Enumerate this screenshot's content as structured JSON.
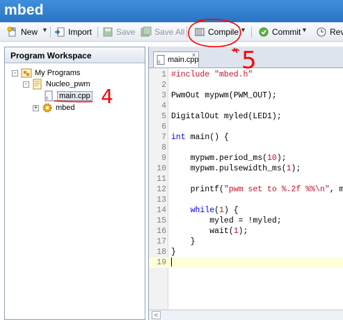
{
  "window": {
    "title": "mbed"
  },
  "toolbar": {
    "new_label": "New",
    "import_label": "Import",
    "save_label": "Save",
    "save_all_label": "Save All",
    "compile_label": "Compile",
    "commit_label": "Commit",
    "revisions_label": "Revi"
  },
  "workspace": {
    "header": "Program Workspace",
    "tree": [
      {
        "label": "My Programs",
        "expander": "-",
        "icon": "programs-folder-icon"
      },
      {
        "label": "Nucleo_pwm",
        "expander": "-",
        "icon": "program-icon"
      },
      {
        "label": "main.cpp",
        "expander": "",
        "icon": "cpp-file-icon",
        "selected": true
      },
      {
        "label": "mbed",
        "expander": "+",
        "icon": "gear-library-icon"
      }
    ]
  },
  "editor": {
    "tab_label": "main.cpp",
    "current_line": 19,
    "lines": [
      {
        "n": "1",
        "html": "<span class=\"pp\">#include \"mbed.h\"</span>"
      },
      {
        "n": "2",
        "html": ""
      },
      {
        "n": "3",
        "html": "PwmOut mypwm(PWM_OUT);"
      },
      {
        "n": "4",
        "html": ""
      },
      {
        "n": "5",
        "html": "DigitalOut myled(LED1);"
      },
      {
        "n": "6",
        "html": ""
      },
      {
        "n": "7",
        "html": "<span class=\"kw\">int</span> main() {"
      },
      {
        "n": "8",
        "html": ""
      },
      {
        "n": "9",
        "html": "    mypwm.period_ms(<span class=\"num\">10</span>);"
      },
      {
        "n": "10",
        "html": "    mypwm.pulsewidth_ms(<span class=\"num\">1</span>);"
      },
      {
        "n": "11",
        "html": ""
      },
      {
        "n": "12",
        "html": "    printf(<span class=\"str\">\"pwm set to %.2f %%\\n\"</span>, m"
      },
      {
        "n": "13",
        "html": ""
      },
      {
        "n": "14",
        "html": "    <span class=\"kw\">while</span>(<span class=\"num\">1</span>) {"
      },
      {
        "n": "15",
        "html": "        myled = !myled;"
      },
      {
        "n": "16",
        "html": "        wait(<span class=\"num\">1</span>);"
      },
      {
        "n": "17",
        "html": "    }"
      },
      {
        "n": "18",
        "html": "}"
      },
      {
        "n": "19",
        "html": ""
      }
    ]
  },
  "annotations": {
    "step_four": "4",
    "step_five": "5",
    "ink_color": "#ff0000"
  },
  "colors": {
    "title_bar": "#3a86d4",
    "keyword": "#0000ff",
    "string": "#c0152b"
  }
}
